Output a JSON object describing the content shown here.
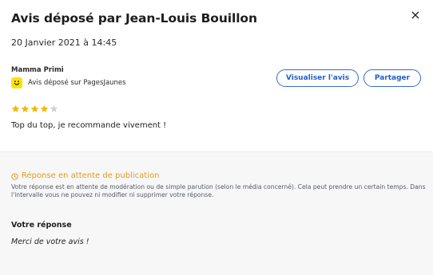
{
  "modal": {
    "title": "Avis déposé par Jean-Louis Bouillon",
    "close_label": "×"
  },
  "review": {
    "date": "20 Janvier 2021 à 14:45",
    "establishment": "Mamma Primi",
    "source_label": "Avis déposé sur PagesJaunes",
    "source_icon": "pagesjaunes-smiley-icon",
    "source_icon_color": "#FFE400",
    "rating": 4,
    "rating_max": 5,
    "star_color": "#F5B800",
    "star_empty_color": "#D3D3D3",
    "text": "Top du top, je recommande vivement !"
  },
  "actions": {
    "view_label": "Visualiser l'avis",
    "share_label": "Partager",
    "accent_color": "#2F6ED3"
  },
  "response": {
    "status_icon": "clock-icon",
    "status_title": "Réponse en attente de publication",
    "status_color": "#E89A16",
    "status_text": "Votre réponse est en attente de modération ou de simple parution (selon le média concerné). Cela peut prendre un certain temps. Dans l'intervalle vous ne pouvez ni modifier ni supprimer votre réponse.",
    "label": "Votre réponse",
    "text": "Merci de votre avis !"
  }
}
